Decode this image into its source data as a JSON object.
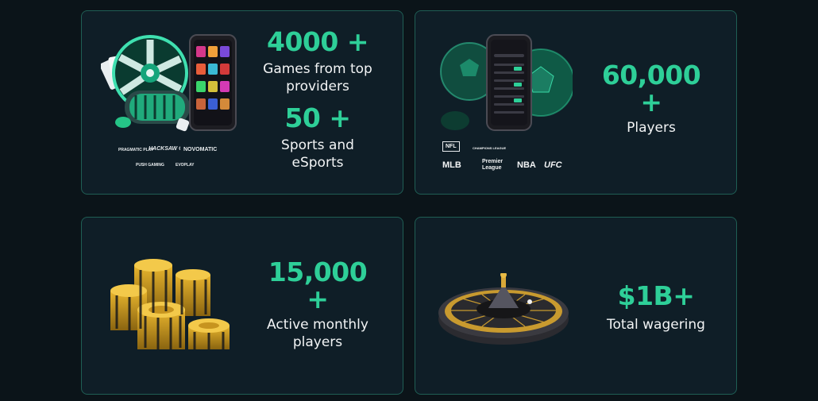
{
  "cards": [
    {
      "stat1_value": "4000 +",
      "stat1_label": "Games from top providers",
      "stat2_value": "50 +",
      "stat2_label": "Sports and eSports",
      "provider_logos": [
        "PRAGMATIC PLAY",
        "HACKSAW GAMING",
        "NOVOMATIC",
        "PUSH GAMING",
        "EVOPLAY"
      ]
    },
    {
      "stat_value": "60,000",
      "stat_plus": "+",
      "stat_label": "Players",
      "league_logos": [
        "NFL",
        "CHAMPIONS LEAGUE",
        "MLB",
        "Premier League",
        "NBA",
        "UFC"
      ]
    },
    {
      "stat_value": "15,000",
      "stat_plus": "+",
      "stat_label": "Active monthly players"
    },
    {
      "stat_value": "$1B+",
      "stat_label": "Total wagering"
    }
  ],
  "colors": {
    "accent": "#2ecf98",
    "card_bg": "#0f1e27",
    "card_border": "#1f5e54",
    "page_bg": "#0b1419"
  }
}
